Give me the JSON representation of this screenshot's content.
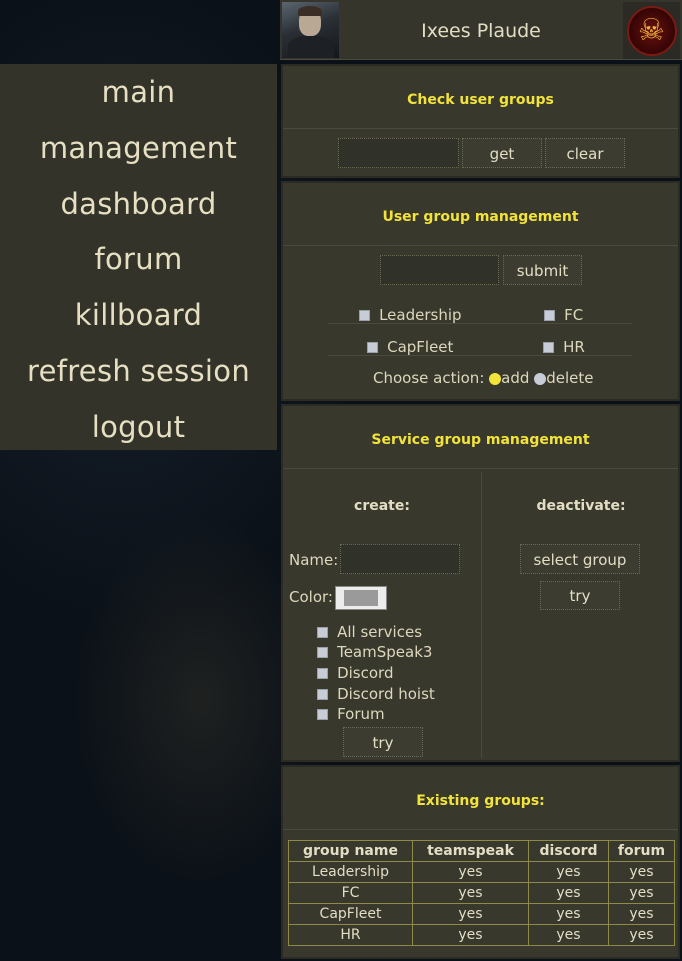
{
  "header": {
    "username": "Ixees Plaude",
    "avatar": "character-portrait",
    "corp_logo_icon": "skull-logo-icon"
  },
  "sidebar": {
    "items": [
      {
        "label": "main"
      },
      {
        "label": "management"
      },
      {
        "label": "dashboard"
      },
      {
        "label": "forum"
      },
      {
        "label": "killboard"
      },
      {
        "label": "refresh session"
      },
      {
        "label": "logout"
      }
    ]
  },
  "check_user_groups": {
    "title": "Check user groups",
    "input_value": "",
    "get_label": "get",
    "clear_label": "clear"
  },
  "user_group_management": {
    "title": "User group management",
    "input_value": "",
    "submit_label": "submit",
    "groups": [
      {
        "label": "Leadership"
      },
      {
        "label": "FC"
      },
      {
        "label": "CapFleet"
      },
      {
        "label": "HR"
      }
    ],
    "choose_action_label": "Choose action:",
    "add_label": "add",
    "delete_label": "delete",
    "selected_action": "add"
  },
  "service_group_management": {
    "title": "Service group management",
    "create_label": "create:",
    "deactivate_label": "deactivate:",
    "name_label": "Name:",
    "name_value": "",
    "color_label": "Color:",
    "color_value": "#9a9a9a",
    "services": [
      {
        "label": "All services"
      },
      {
        "label": "TeamSpeak3"
      },
      {
        "label": "Discord"
      },
      {
        "label": "Discord hoist"
      },
      {
        "label": "Forum"
      }
    ],
    "create_try_label": "try",
    "select_group_label": "select group",
    "deactivate_try_label": "try"
  },
  "existing_groups": {
    "title": "Existing groups:",
    "columns": [
      "group name",
      "teamspeak",
      "discord",
      "forum"
    ],
    "rows": [
      [
        "Leadership",
        "yes",
        "yes",
        "yes"
      ],
      [
        "FC",
        "yes",
        "yes",
        "yes"
      ],
      [
        "CapFleet",
        "yes",
        "yes",
        "yes"
      ],
      [
        "HR",
        "yes",
        "yes",
        "yes"
      ]
    ]
  },
  "colors": {
    "accent_title": "#f2e33a",
    "panel_bg": "#38382d",
    "radio_selected": "#f2e33a",
    "radio_unselected": "#c8ccd6"
  }
}
